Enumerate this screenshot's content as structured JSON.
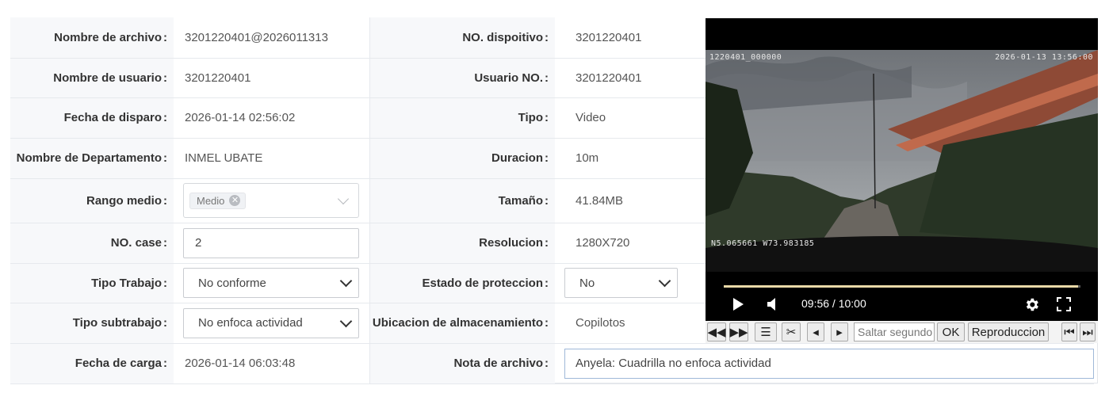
{
  "fields": {
    "file_name": {
      "label": "Nombre de archivo",
      "value": "3201220401@2026011313"
    },
    "device_no": {
      "label": "NO. dispoitivo",
      "value": "3201220401"
    },
    "user_name": {
      "label": "Nombre de usuario",
      "value": "3201220401"
    },
    "user_no": {
      "label": "Usuario NO.",
      "value": "3201220401"
    },
    "trigger_date": {
      "label": "Fecha de disparo",
      "value": "2026-01-14 02:56:02"
    },
    "type": {
      "label": "Tipo",
      "value": "Video"
    },
    "department": {
      "label": "Nombre de Departamento",
      "value": "INMEL UBATE"
    },
    "duration": {
      "label": "Duracion",
      "value": "10m"
    },
    "media_range": {
      "label": "Rango medio",
      "tag": "Medio"
    },
    "size": {
      "label": "Tamaño",
      "value": "41.84MB"
    },
    "case_no": {
      "label": "NO. case",
      "value": "2"
    },
    "resolution": {
      "label": "Resolucion",
      "value": "1280X720"
    },
    "work_type": {
      "label": "Tipo Trabajo",
      "value": "No conforme"
    },
    "protection_state": {
      "label": "Estado de proteccion",
      "value": "No"
    },
    "work_subtype": {
      "label": "Tipo subtrabajo",
      "value": "No enfoca actividad"
    },
    "storage_location": {
      "label": "Ubicacion de almacenamiento",
      "value": "Copilotos"
    },
    "upload_date": {
      "label": "Fecha de carga",
      "value": "2026-01-14 06:03:48"
    },
    "file_note": {
      "label": "Nota de archivo",
      "value": "Anyela: Cuadrilla no enfoca actividad"
    }
  },
  "colon": ":",
  "player": {
    "osd_top_left": "1220401_000000",
    "osd_top_right": "2026-01-13 13:56:00",
    "osd_gps": "N5.065661  W73.983185",
    "time_display": "09:56 / 10:00",
    "progress": 0.993
  },
  "toolbar": {
    "jump_placeholder": "Saltar segundo",
    "ok_label": "OK",
    "playback_label": "Reproduccion"
  },
  "colors": {
    "label_bg": "#f7f8fa",
    "border": "#e6e9ed",
    "progress": "#e9d9a8"
  }
}
